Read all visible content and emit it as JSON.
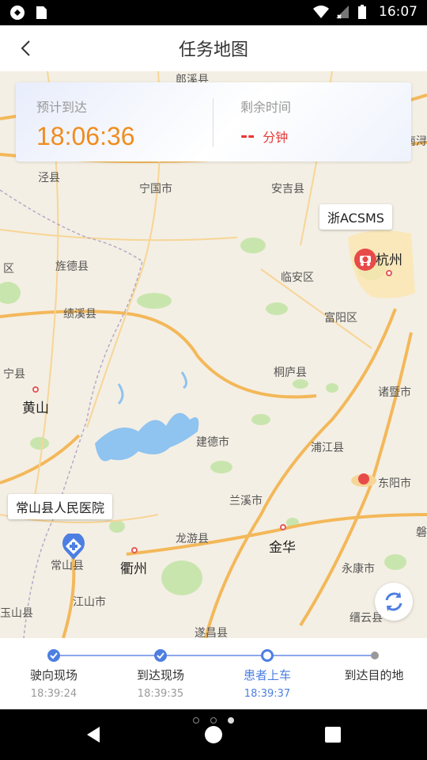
{
  "status_bar": {
    "time": "16:07"
  },
  "header": {
    "title": "任务地图"
  },
  "info_card": {
    "eta_caption": "预计到达",
    "eta_time": "18:06:36",
    "remaining_caption": "剩余时间",
    "remaining_value": "--",
    "remaining_unit": "分钟"
  },
  "map": {
    "labels": {
      "langxi": "郎溪县",
      "nanxun": "南浔",
      "jingxian": "泾县",
      "ningguo": "宁国市",
      "anji": "安吉县",
      "jingde": "旌德县",
      "qu": "区",
      "linan": "临安区",
      "hangzhou": "杭州",
      "jixi": "绩溪县",
      "fuyang": "富阳区",
      "tongLu": "桐庐县",
      "ningxian": "宁县",
      "huangshan": "黄山",
      "zhuji": "诸暨市",
      "jiande": "建德市",
      "pujiang": "浦江县",
      "dongyang": "东阳市",
      "lanxi": "兰溪市",
      "longyou": "龙游县",
      "jinhua": "金华",
      "changshan": "常山县",
      "quzhou": "衢州",
      "yongkang": "永康市",
      "jiangshan": "江山市",
      "yushan": "玉山县",
      "jinyun": "缙云县",
      "suichang": "遂昌县",
      "pan": "磐"
    },
    "vehicle_callout": "浙ACSMS",
    "hospital_callout": "常山县人民医院",
    "colors": {
      "highway": "#f3b85a",
      "lake": "#8fc3f0",
      "green": "#c5e3a6",
      "route": "#4d7fe2"
    }
  },
  "progress": {
    "steps": [
      {
        "name": "驶向现场",
        "time": "18:39:24",
        "state": "done"
      },
      {
        "name": "到达现场",
        "time": "18:39:35",
        "state": "done"
      },
      {
        "name": "患者上车",
        "time": "18:39:37",
        "state": "current"
      },
      {
        "name": "到达目的地",
        "time": "",
        "state": "pending"
      }
    ]
  }
}
